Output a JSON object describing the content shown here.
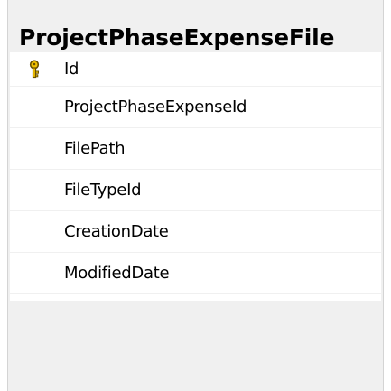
{
  "table": {
    "title": "ProjectPhaseExpenseFile",
    "columns": [
      {
        "name": "Id",
        "primary_key": true,
        "icon": "primary-key-icon"
      },
      {
        "name": "ProjectPhaseExpenseId",
        "primary_key": false
      },
      {
        "name": "FilePath",
        "primary_key": false
      },
      {
        "name": "FileTypeId",
        "primary_key": false
      },
      {
        "name": "CreationDate",
        "primary_key": false
      },
      {
        "name": "ModifiedDate",
        "primary_key": false
      }
    ]
  },
  "colors": {
    "panel_background": "#f0f0f0",
    "column_background": "#ffffff",
    "border": "#d4d4d4",
    "key_icon": "#e8b800"
  }
}
